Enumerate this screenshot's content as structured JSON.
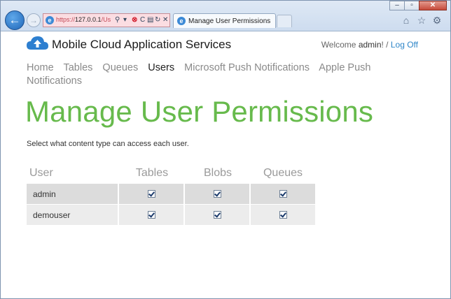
{
  "browser": {
    "address_url": "https://127.0.0.1/Us",
    "address_host": "127.0.0.1",
    "tab_title": "Manage User Permissions",
    "window_buttons": [
      "–",
      "▫",
      "✕"
    ],
    "toolbar_icons": [
      "home-icon",
      "star-icon",
      "gear-icon"
    ]
  },
  "header": {
    "site_title": "Mobile Cloud Application Services",
    "welcome_prefix": "Welcome ",
    "welcome_user": "admin",
    "welcome_suffix": "! / ",
    "logoff_label": "Log Off"
  },
  "nav": {
    "items": [
      "Home",
      "Tables",
      "Queues",
      "Users",
      "Microsoft Push Notifications",
      "Apple Push Notifications"
    ],
    "active": "Users"
  },
  "page": {
    "title": "Manage User Permissions",
    "instructions": "Select what content type can access each user."
  },
  "table": {
    "headers": [
      "User",
      "Tables",
      "Blobs",
      "Queues"
    ],
    "rows": [
      {
        "user": "admin",
        "tables": true,
        "blobs": true,
        "queues": true
      },
      {
        "user": "demouser",
        "tables": true,
        "blobs": true,
        "queues": true
      }
    ]
  },
  "colors": {
    "accent_green": "#67ba4c",
    "link_blue": "#2f86c8"
  }
}
